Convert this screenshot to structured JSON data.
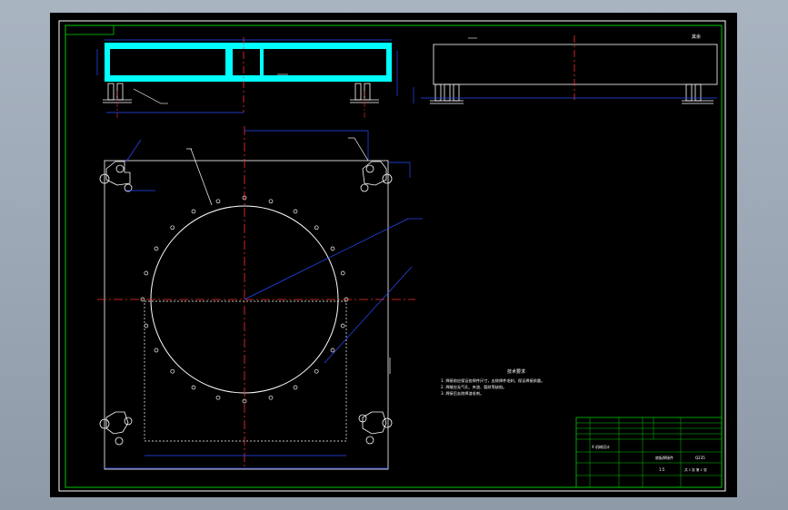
{
  "drawing": {
    "tech_notes_title": "技术要求",
    "tech_notes": [
      "1. 焊接前应保证各焊件尺寸，去除焊件毛刺，保证焊接质量。",
      "2. 焊缝应无气孔、夹渣、裂纹等缺陷。",
      "3. 焊接后去除焊渣毛刺。"
    ],
    "title_block": {
      "drawing_name": "底板焊接件",
      "material": "Q235",
      "scale": "1:5",
      "sheet": "共 1 张  第 1 张",
      "project": "X 机械设计"
    },
    "corner_mark": "其余"
  }
}
